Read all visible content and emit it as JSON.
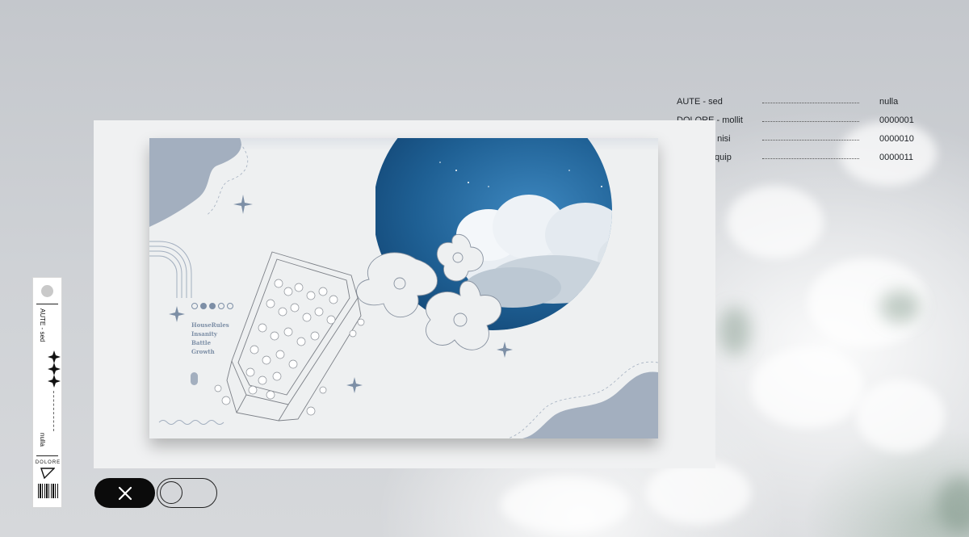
{
  "info_list": [
    {
      "key": "AUTE  -  sed",
      "value": "nulla"
    },
    {
      "key": "DOLORE  -  mollit",
      "value": "0000001"
    },
    {
      "key": "CILLUM  -  nisi",
      "value": "0000010"
    },
    {
      "key": "DUIS  -  aliquip",
      "value": "0000011"
    }
  ],
  "strip": {
    "top_label": "AUTE  -  sed",
    "bottom_label": "nulla",
    "brand": "DOLORE"
  },
  "slide": {
    "menu": [
      "HouseRules",
      "Insanity",
      "Battle",
      "Growth"
    ]
  },
  "controls": {
    "close_icon": "close-icon",
    "toggle_state": "off"
  },
  "colors": {
    "accent_blue": "#a3afbf",
    "sky_blue": "#1e5f93",
    "control_dark": "#0b0b0b"
  }
}
